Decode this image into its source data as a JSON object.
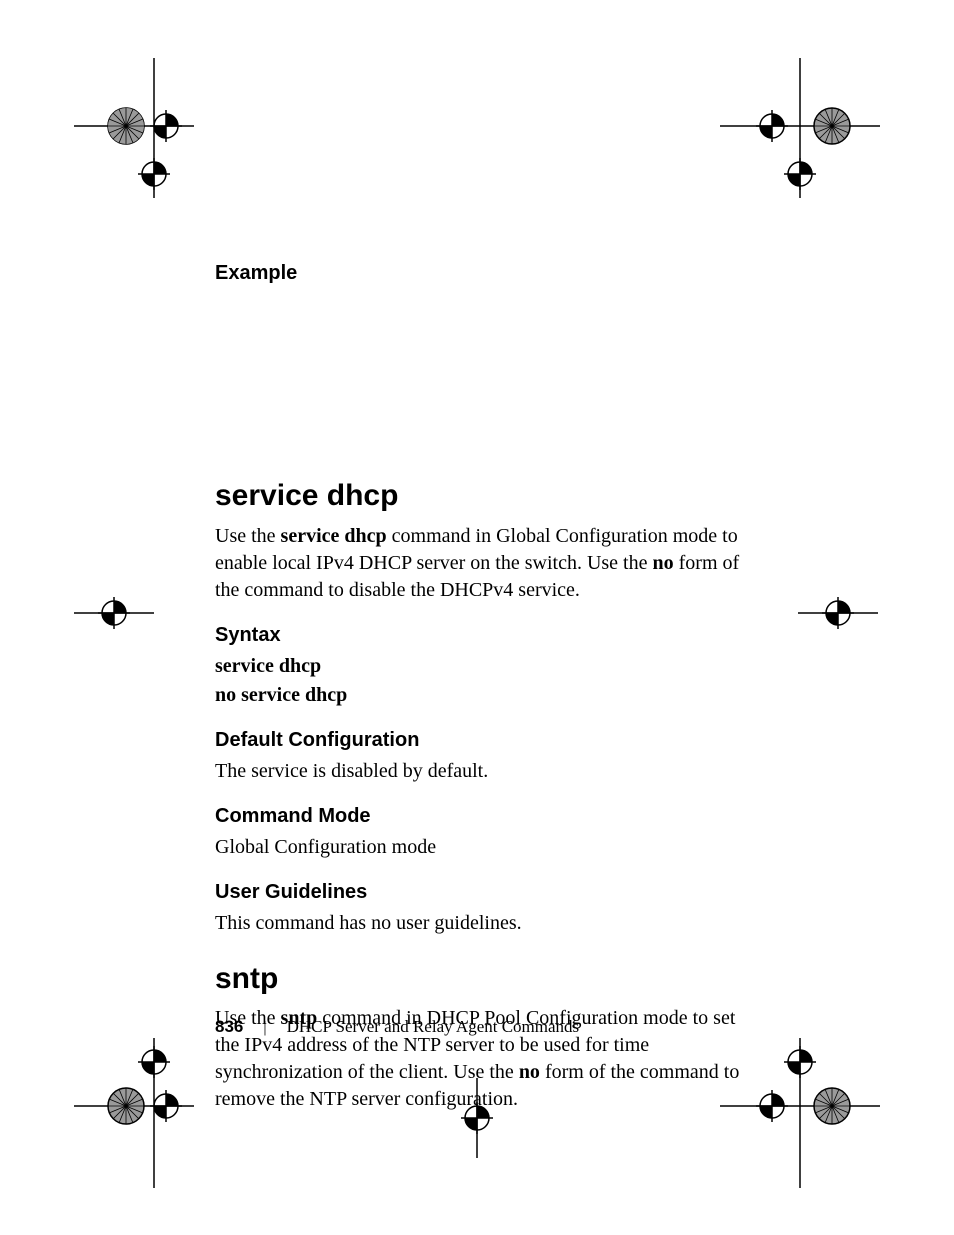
{
  "headings": {
    "example": "Example",
    "service_dhcp": "service dhcp",
    "syntax": "Syntax",
    "default_config": "Default Configuration",
    "command_mode": "Command Mode",
    "user_guidelines": "User Guidelines",
    "sntp": "sntp"
  },
  "body": {
    "service_dhcp_intro_1": "Use the ",
    "service_dhcp_bold": "service dhcp",
    "service_dhcp_intro_2": " command in Global Configuration mode to enable local IPv4 DHCP server on the switch. Use the ",
    "no_bold": "no",
    "service_dhcp_intro_3": " form of the command to disable the DHCPv4 service.",
    "syntax_line1": "service dhcp",
    "syntax_line2": "no service dhcp",
    "default_config_text": "The service is disabled by default.",
    "command_mode_text": "Global Configuration mode",
    "user_guidelines_text": "This command has no user guidelines.",
    "sntp_intro_1": "Use the ",
    "sntp_bold": "sntp",
    "sntp_intro_2": " command in DHCP Pool Configuration mode to set the IPv4 address of the NTP server to be used for time synchronization of the client. Use the ",
    "sntp_intro_3": " form of the command to remove the NTP server configuration."
  },
  "footer": {
    "page_number": "836",
    "separator": "|",
    "section_title": "DHCP Server and Relay Agent Commands"
  }
}
